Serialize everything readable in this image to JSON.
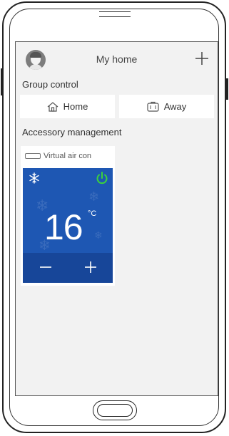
{
  "header": {
    "title": "My home",
    "add_icon": "plus-icon",
    "avatar_icon": "avatar-icon"
  },
  "group_control": {
    "label": "Group control",
    "buttons": [
      {
        "label": "Home",
        "icon": "house-icon"
      },
      {
        "label": "Away",
        "icon": "suitcase-icon"
      }
    ]
  },
  "accessory_management": {
    "label": "Accessory management",
    "devices": [
      {
        "name": "Virtual air con",
        "icon": "air-conditioner-icon",
        "temperature": "16",
        "unit": "°C",
        "mode_icon": "snowflake-icon",
        "power_icon": "power-icon",
        "power_color": "#3cd23c",
        "minus_label": "—",
        "plus_label": "+"
      }
    ]
  },
  "colors": {
    "panel_blue": "#1e57b3",
    "panel_dark_blue": "#174699",
    "screen_bg": "#f2f2f2"
  }
}
